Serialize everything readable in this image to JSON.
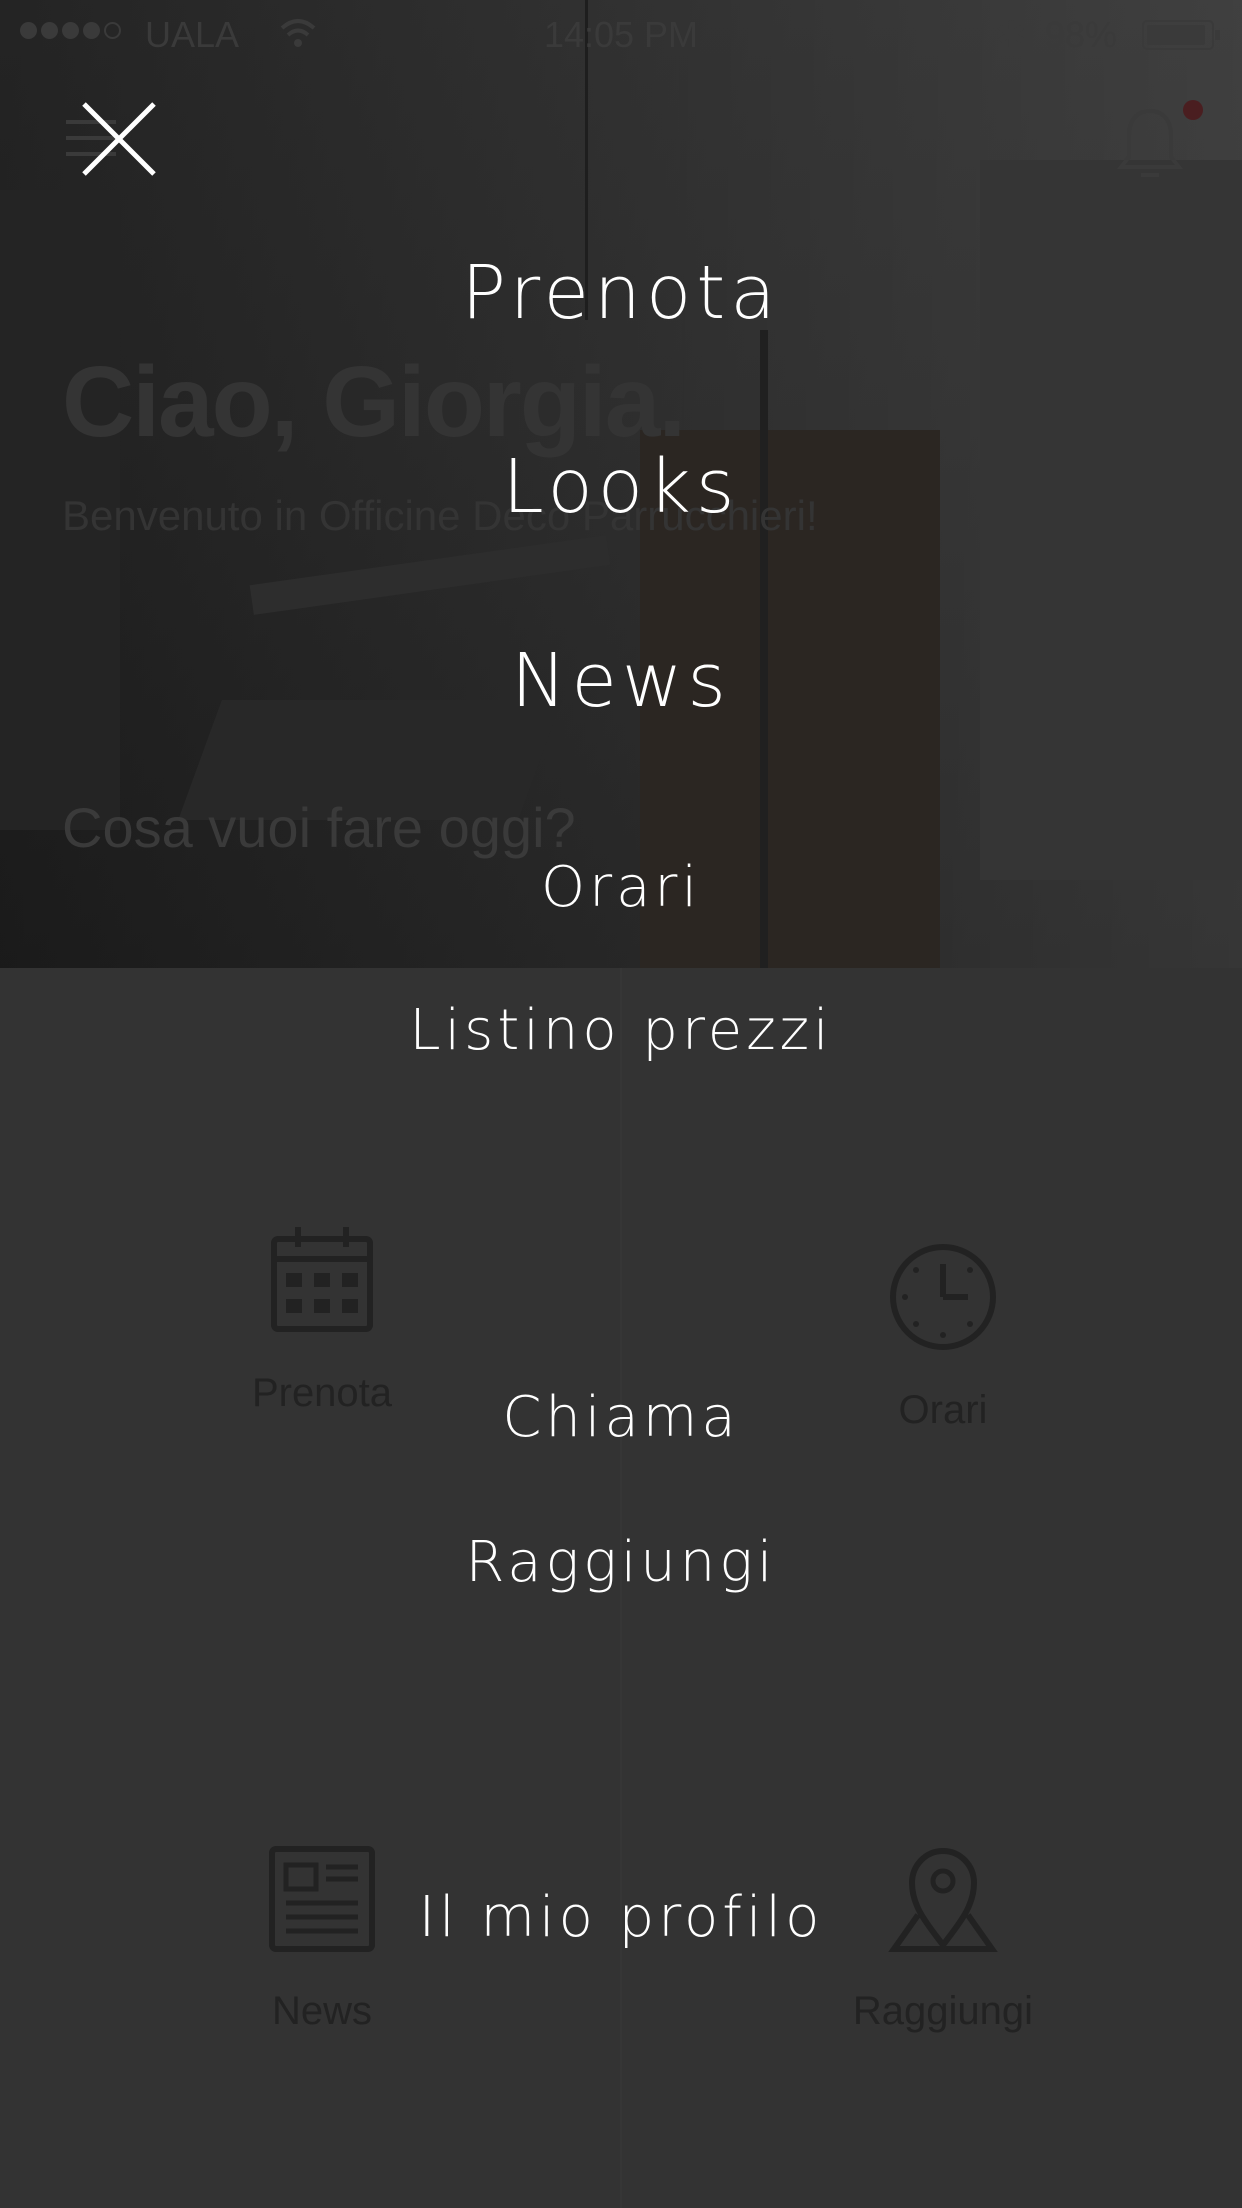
{
  "status_bar": {
    "carrier": "UALA",
    "time": "14:05 PM",
    "battery": "98%"
  },
  "background": {
    "greeting": "Ciao, Giorgia.",
    "welcome": "Benvenuto in Officine Deco Parrucchieri!",
    "question": "Cosa vuoi fare oggi?",
    "tiles": [
      {
        "label": "Prenota",
        "icon": "calendar-icon"
      },
      {
        "label": "Orari",
        "icon": "clock-icon"
      },
      {
        "label": "News",
        "icon": "newspaper-icon"
      },
      {
        "label": "Raggiungi",
        "icon": "map-pin-icon"
      }
    ]
  },
  "menu": {
    "close_icon": "close-icon",
    "items": [
      {
        "label": "Prenota"
      },
      {
        "label": "Looks"
      },
      {
        "label": "News"
      },
      {
        "label": "Orari"
      },
      {
        "label": "Listino prezzi"
      },
      {
        "label": "Chiama"
      },
      {
        "label": "Raggiungi"
      },
      {
        "label": "Il mio profilo"
      }
    ]
  },
  "colors": {
    "overlay_background": "#333333",
    "menu_text": "#ffffff",
    "notification_dot": "#c0262f"
  }
}
